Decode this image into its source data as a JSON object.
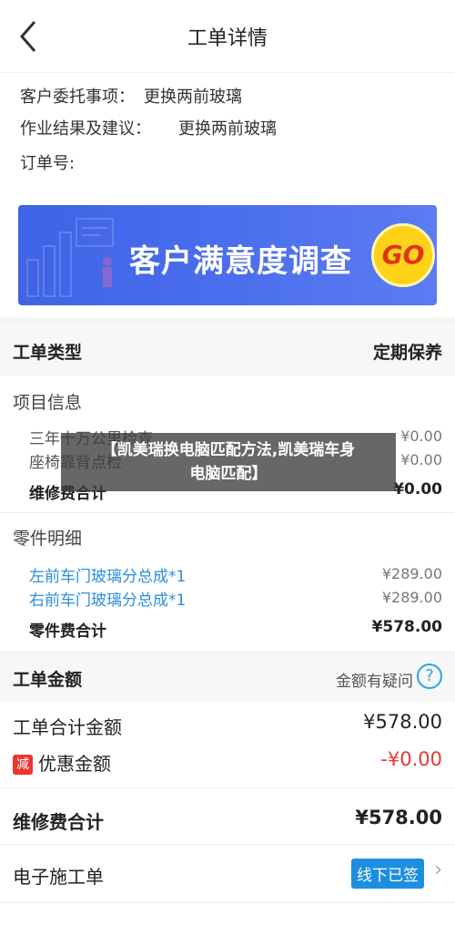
{
  "header": {
    "title": "工单详情"
  },
  "info": {
    "entrust_label": "客户委托事项：",
    "entrust_value": "更换两前玻璃",
    "result_label": "作业结果及建议：",
    "result_value": "更换两前玻璃",
    "order_label": "订单号:"
  },
  "banner": {
    "text": "客户满意度调查",
    "go": "GO"
  },
  "order_type": {
    "label": "工单类型",
    "value": "定期保养"
  },
  "project_info": {
    "title": "项目信息",
    "items": [
      {
        "name": "三年十万公里检查",
        "price": "¥0.00"
      },
      {
        "name": "座椅靠背点检",
        "price": "¥0.00"
      }
    ],
    "total_label": "维修费合计",
    "total_value": "¥0.00"
  },
  "parts": {
    "title": "零件明细",
    "items": [
      {
        "name": "左前车门玻璃分总成*1",
        "price": "¥289.00"
      },
      {
        "name": "右前车门玻璃分总成*1",
        "price": "¥289.00"
      }
    ],
    "total_label": "零件费合计",
    "total_value": "¥578.00"
  },
  "amount": {
    "title": "工单金额",
    "help": "金额有疑问",
    "help_icon": "?",
    "total_label": "工单合计金额",
    "total_value": "¥578.00",
    "discount_badge": "减",
    "discount_label": "优惠金额",
    "discount_value": "-¥0.00",
    "repair_total_label": "维修费合计",
    "repair_total_value": "¥578.00"
  },
  "e_order": {
    "label": "电子施工单",
    "badge": "线下已签"
  },
  "overlay": {
    "line1": "【凯美瑞换电脑匹配方法,凯美瑞车身",
    "line2": "电脑匹配】"
  },
  "colors": {
    "link_blue": "#2b8ee0",
    "discount_red": "#e8382e",
    "badge_blue": "#1d8fe0"
  }
}
